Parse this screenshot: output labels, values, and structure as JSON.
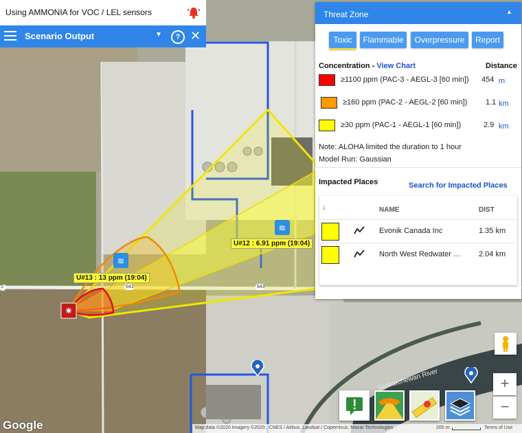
{
  "app": {
    "title": "Using AMMONIA for VOC / LEL sensors",
    "bell_icon": "alarm-bell-icon"
  },
  "scenario_bar": {
    "label": "Scenario Output",
    "menu_icon": "hamburger-menu-icon",
    "help_label": "?",
    "close_label": "✕"
  },
  "threat_zone": {
    "title": "Threat Zone",
    "collapse_icon": "▲",
    "tabs": [
      {
        "label": "Toxic",
        "active": true
      },
      {
        "label": "Flammable",
        "active": false
      },
      {
        "label": "Overpressure",
        "active": false
      },
      {
        "label": "Report",
        "active": false
      }
    ],
    "concentration_label": "Concentration - ",
    "view_chart_label": "View Chart",
    "distance_label": "Distance",
    "rows": [
      {
        "color": "#ff0000",
        "text": "≥1100 ppm (PAC-3 - AEGL-3 [60 min])",
        "value": "454",
        "unit": "m"
      },
      {
        "color": "#ff9900",
        "text": "≥160 ppm (PAC-2 - AEGL-2 [60 min])",
        "value": "1.1",
        "unit": "km"
      },
      {
        "color": "#ffff00",
        "text": "≥30 ppm (PAC-1 - AEGL-1 [60 min])",
        "value": "2.9",
        "unit": "km"
      }
    ],
    "note": "Note: ALOHA limited the duration to 1 hour",
    "model_run": "Model Run: Gaussian",
    "impacted_title": "Impacted Places",
    "impacted_link": "Search for Impacted Places",
    "table": {
      "sort_icon": "↓",
      "col_name": "NAME",
      "col_dist": "DIST",
      "rows": [
        {
          "name": "Evonik Canada Inc",
          "dist": "1.35 km"
        },
        {
          "name": "North West Redwater …",
          "dist": "2.04 km"
        }
      ]
    }
  },
  "map": {
    "sensor_labels": [
      "U#13 : 13 ppm (19:04)",
      "U#12 : 6.91 ppm (19:04)"
    ],
    "road_labels": [
      "643",
      "643",
      "643",
      "3"
    ],
    "river_label": "Saskatchewan River",
    "google": "Google",
    "attribution": "Map data ©2020 Imagery ©2020 , CNES / Airbus, Landsat / Copernicus, Maxar Technologies",
    "scale": "200 m",
    "terms": "Terms of Use",
    "zoom_in": "+",
    "zoom_out": "−"
  }
}
